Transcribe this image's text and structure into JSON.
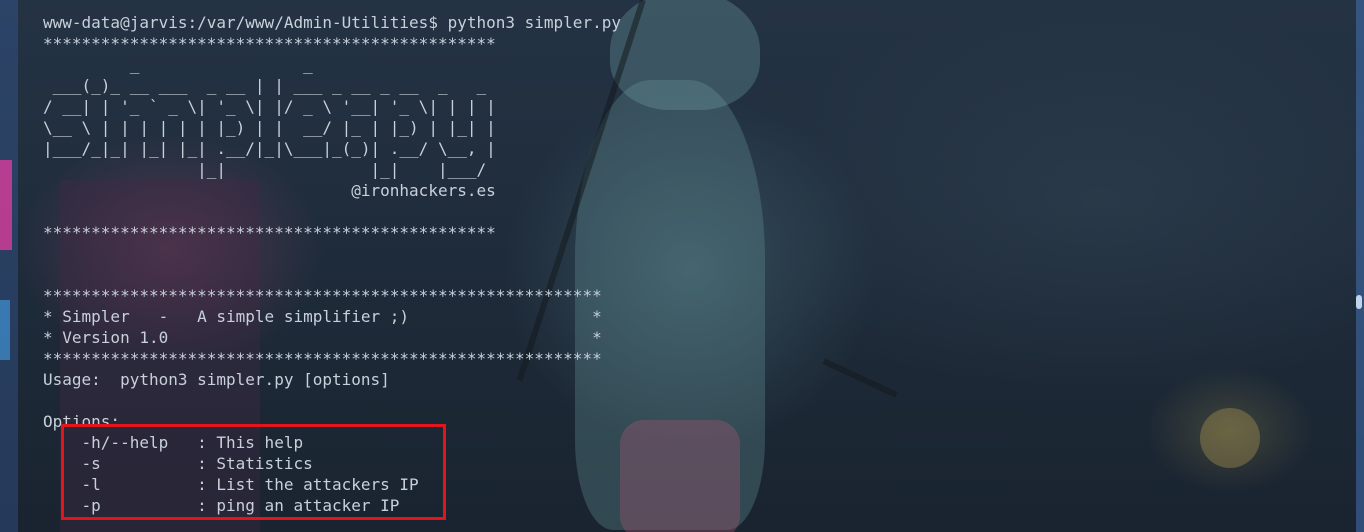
{
  "terminal": {
    "prompt": "www-data@jarvis:/var/www/Admin-Utilities$ python3 simpler.py",
    "stars_short": "***********************************************",
    "ascii_banner": "         _                 _\n ___(_)_ __ ___  _ __ | | ___ _ __ _ __  _   _\n/ __| | '_ ` _ \\| '_ \\| |/ _ \\ '__| '_ \\| | | |\n\\__ \\ | | | | | | |_) | |  __/ |_ | |_) | |_| |\n|___/_|_| |_| |_| .__/|_|\\___|_(_)| .__/ \\__, |\n                |_|               |_|    |___/",
    "handle": "                                @ironhackers.es",
    "stars_long": "**********************************************************",
    "title_line": "* Simpler   -   A simple simplifier ;)                   *",
    "version_line": "* Version 1.0                                            *",
    "usage": "Usage:  python3 simpler.py [options]",
    "options_header": "Options:",
    "options": [
      {
        "flag": "    -h/--help   ",
        "desc": ": This help"
      },
      {
        "flag": "    -s          ",
        "desc": ": Statistics"
      },
      {
        "flag": "    -l          ",
        "desc": ": List the attackers IP"
      },
      {
        "flag": "    -p          ",
        "desc": ": ping an attacker IP"
      }
    ]
  },
  "colors": {
    "text": "#c8d0da",
    "highlight_border": "#e3141b",
    "background": "#1b2531"
  }
}
